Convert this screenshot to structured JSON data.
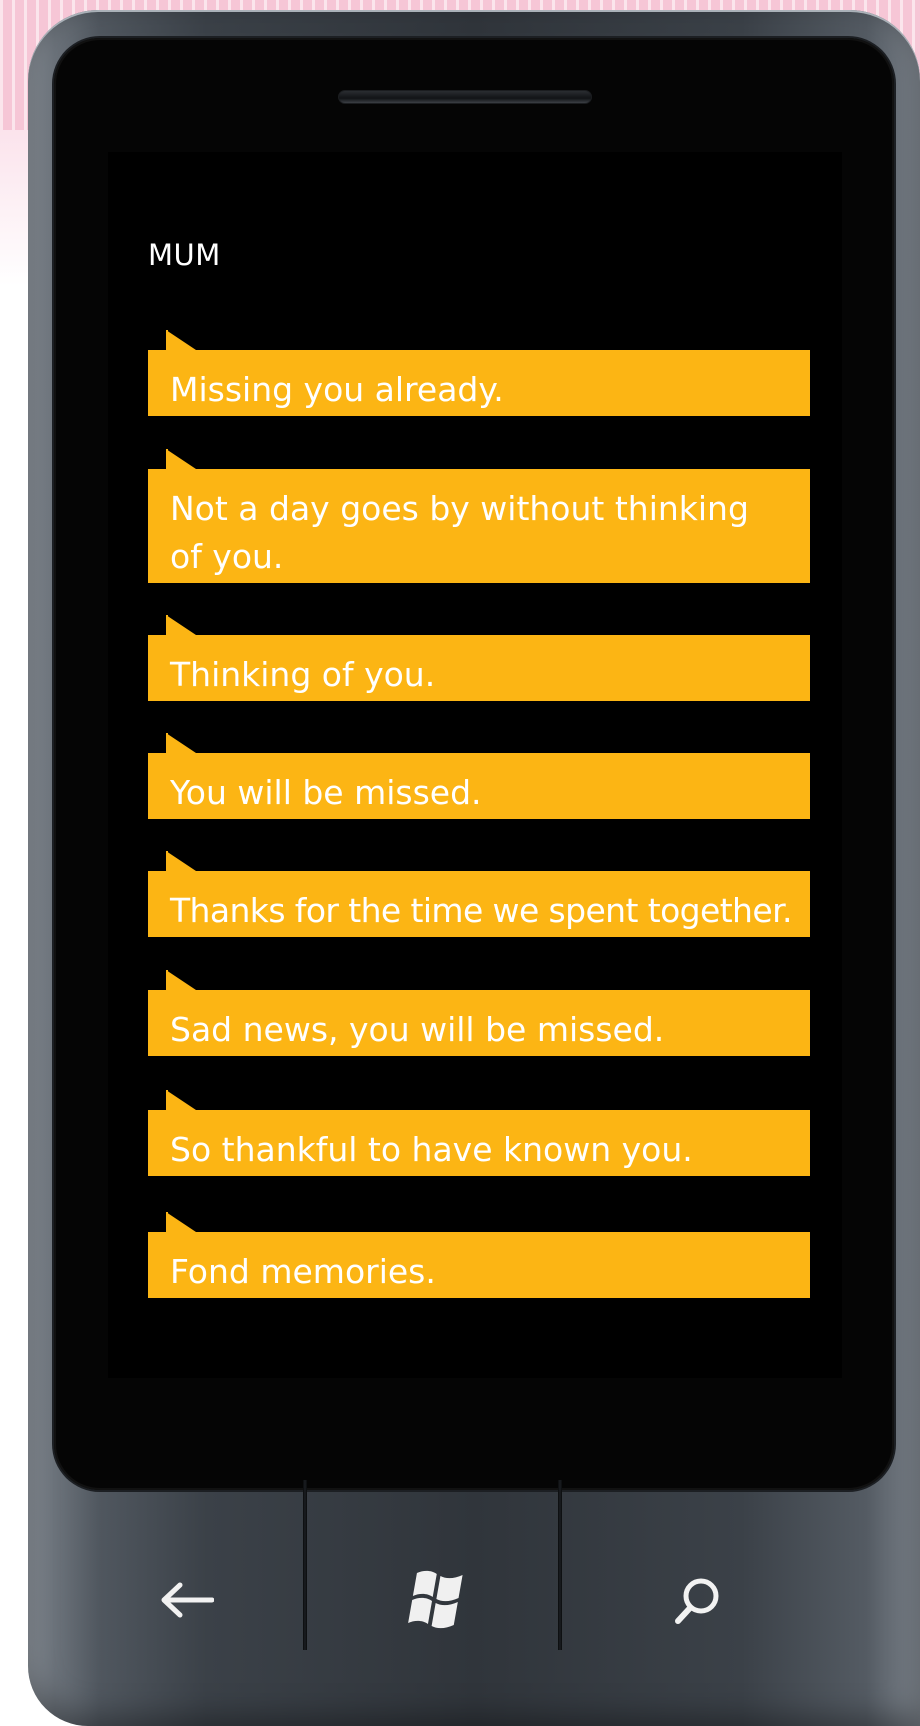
{
  "conversation": {
    "contact_name": "MUM",
    "messages": [
      {
        "text": "Missing you already."
      },
      {
        "text": "Not a day goes by without thinking of you."
      },
      {
        "text": "Thinking of you."
      },
      {
        "text": "You will be missed."
      },
      {
        "text": "Thanks for the time we spent together."
      },
      {
        "text": "Sad news, you will be missed."
      },
      {
        "text": "So thankful to have known you."
      },
      {
        "text": "Fond memories."
      }
    ]
  },
  "hardware_keys": {
    "back": {
      "icon": "back-arrow-icon"
    },
    "start": {
      "icon": "windows-logo-icon"
    },
    "search": {
      "icon": "search-icon"
    }
  },
  "colors": {
    "bubble": "#fcb514",
    "screen_background": "#000000",
    "text": "#ffffff"
  }
}
